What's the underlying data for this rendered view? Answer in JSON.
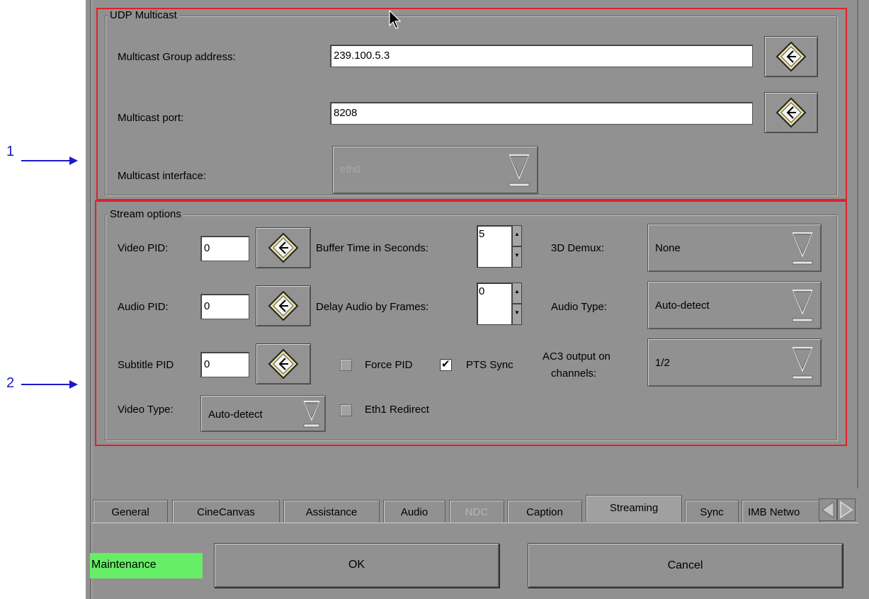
{
  "annotations": [
    {
      "label": "1"
    },
    {
      "label": "2"
    }
  ],
  "udp": {
    "title": "UDP Multicast",
    "group_label": "Multicast Group address:",
    "group_value": "239.100.5.3",
    "port_label": "Multicast port:",
    "port_value": "8208",
    "interface_label": "Multicast interface:",
    "interface_value": "eth0"
  },
  "stream": {
    "title": "Stream options",
    "video_pid_label": "Video PID:",
    "video_pid_value": "0",
    "audio_pid_label": "Audio PID:",
    "audio_pid_value": "0",
    "subtitle_pid_label": "Subtitle PID",
    "subtitle_pid_value": "0",
    "buffer_label": "Buffer Time in Seconds:",
    "buffer_value": "5",
    "delay_label": "Delay Audio by Frames:",
    "delay_value": "0",
    "force_pid_label": "Force PID",
    "force_pid_checked": false,
    "pts_sync_label": "PTS Sync",
    "pts_sync_checked": true,
    "eth1_label": "Eth1 Redirect",
    "eth1_checked": false,
    "demux_label": "3D Demux:",
    "demux_value": "None",
    "audio_type_label": "Audio Type:",
    "audio_type_value": "Auto-detect",
    "ac3_label_1": "AC3 output on",
    "ac3_label_2": "channels:",
    "ac3_value": "1/2",
    "video_type_label": "Video Type:",
    "video_type_value": "Auto-detect"
  },
  "tabs": [
    {
      "label": "General"
    },
    {
      "label": "CineCanvas"
    },
    {
      "label": "Assistance"
    },
    {
      "label": "Audio"
    },
    {
      "label": "NDC",
      "disabled": true
    },
    {
      "label": "Caption"
    },
    {
      "label": "Streaming",
      "active": true
    },
    {
      "label": "Sync"
    },
    {
      "label": "IMB Netwo"
    }
  ],
  "footer": {
    "status": "Maintenance",
    "ok": "OK",
    "cancel": "Cancel"
  },
  "colors": {
    "panel": "#919191",
    "highlight_box": "#e0202a",
    "annotation": "#1a1acc",
    "status_bg": "#66ee66"
  },
  "icons": {
    "keyboard_button": "edit-keyboard-icon",
    "dropdown": "dropdown-triangle-icon",
    "cursor": "mouse-pointer-icon"
  }
}
